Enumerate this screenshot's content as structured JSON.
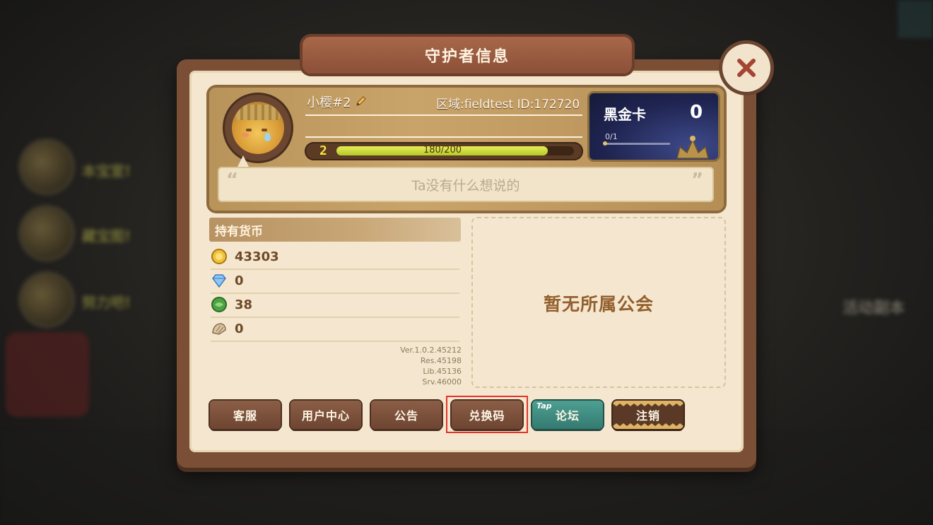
{
  "background": {
    "side_items": [
      "本宝室!",
      "藏宝图!",
      "努力吧!"
    ],
    "right_label": "活动副本"
  },
  "dialog": {
    "title": "守护者信息",
    "close_icon": "close-icon"
  },
  "profile": {
    "name": "小樱#2",
    "region_id": "区域:fieldtest ID:172720",
    "level": "2",
    "xp_text": "180/200",
    "xp_fraction": 0.9,
    "motto": "Ta没有什么想说的",
    "quote_open": "“",
    "quote_close": "”"
  },
  "vip_card": {
    "title": "黑金卡",
    "count": "0",
    "progress_text": "0/1"
  },
  "currencies": {
    "title": "持有货币",
    "items": [
      {
        "icon": "gold-coin-icon",
        "value": "43303"
      },
      {
        "icon": "diamond-icon",
        "value": "0"
      },
      {
        "icon": "green-orb-icon",
        "value": "38"
      },
      {
        "icon": "shell-icon",
        "value": "0"
      }
    ]
  },
  "version": {
    "ver": "Ver.1.0.2.45212",
    "res": "Res.45198",
    "lib": "Lib.45136",
    "srv": "Srv.46000"
  },
  "guild": {
    "empty_text": "暂无所属公会"
  },
  "buttons": {
    "support": "客服",
    "user_center": "用户中心",
    "notice": "公告",
    "redeem": "兑换码",
    "forum_tap": "Tap",
    "forum": "论坛",
    "logout": "注销"
  },
  "colors": {
    "panel_brown": "#7a4f36",
    "parchment": "#f5e7cf",
    "xp_yellow": "#e6ee55",
    "highlight_red": "#e2332b"
  }
}
